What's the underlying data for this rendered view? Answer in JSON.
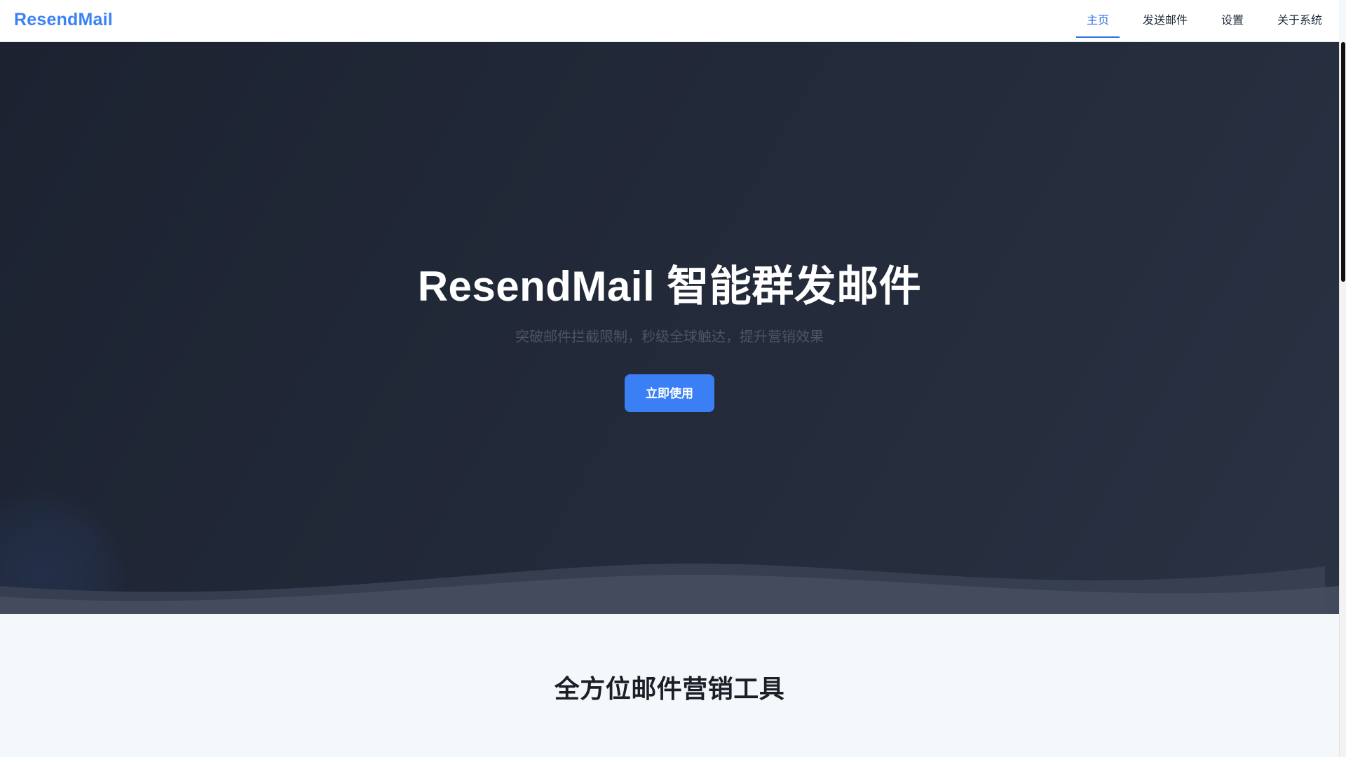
{
  "header": {
    "brand": "ResendMail",
    "nav": [
      {
        "label": "主页",
        "active": true
      },
      {
        "label": "发送邮件",
        "active": false
      },
      {
        "label": "设置",
        "active": false
      },
      {
        "label": "关于系统",
        "active": false
      }
    ]
  },
  "hero": {
    "title": "ResendMail 智能群发邮件",
    "subtitle": "突破邮件拦截限制，秒级全球触达，提升营销效果",
    "cta_label": "立即使用"
  },
  "features": {
    "title": "全方位邮件营销工具"
  },
  "colors": {
    "accent": "#3b82f6",
    "hero_bg": "#1f2533",
    "cta": "#3b7ff5"
  }
}
